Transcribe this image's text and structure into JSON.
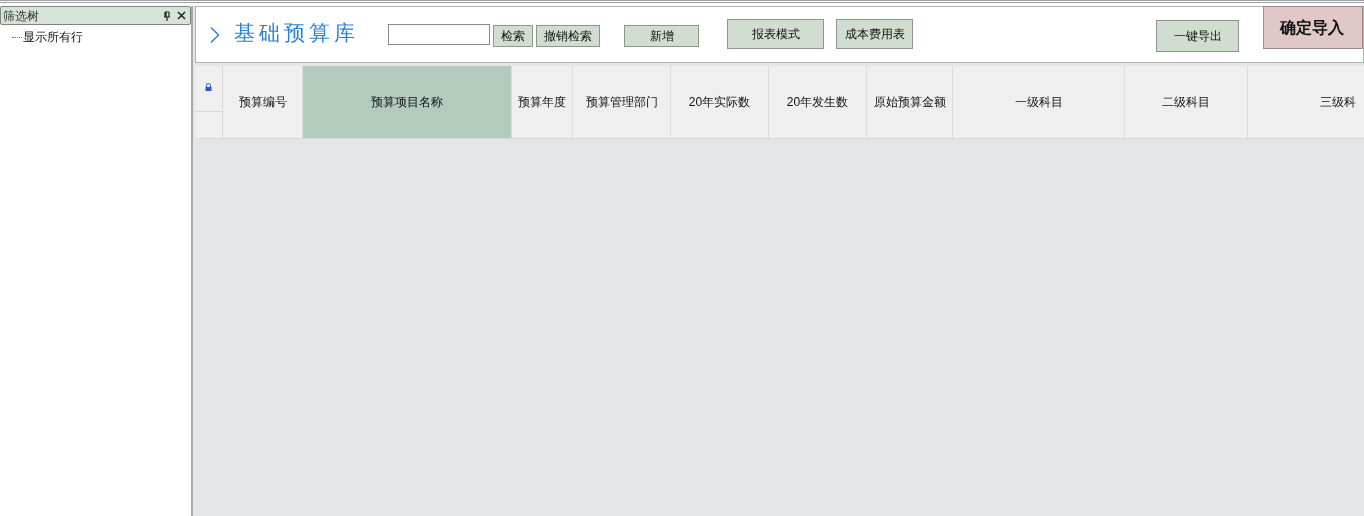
{
  "tree_panel": {
    "title": "筛选树",
    "items": [
      {
        "label": "显示所有行"
      }
    ]
  },
  "toolbar": {
    "title": "基础预算库",
    "buttons": [
      {
        "label": "检索",
        "kind": "small"
      },
      {
        "label": "撤销检索",
        "kind": "small"
      },
      {
        "label": "新增",
        "kind": "medium"
      },
      {
        "label": "报表模式",
        "kind": "large"
      },
      {
        "label": "成本费用表",
        "kind": "large"
      },
      {
        "label": "一键导出",
        "kind": "export"
      },
      {
        "label": "确定导入",
        "kind": "primary"
      }
    ]
  },
  "table": {
    "columns": [
      {
        "label": "预算编号",
        "selected": false
      },
      {
        "label": "预算项目名称",
        "selected": true
      },
      {
        "label": "预算年度",
        "selected": false
      },
      {
        "label": "预算管理部门",
        "selected": false
      },
      {
        "label": "20年实际数",
        "selected": false
      },
      {
        "label": "20年发生数",
        "selected": false
      },
      {
        "label": "原始预算金额",
        "selected": false
      },
      {
        "label": "一级科目",
        "selected": false
      },
      {
        "label": "二级科目",
        "selected": false
      },
      {
        "label": "三级科",
        "selected": false
      }
    ]
  }
}
